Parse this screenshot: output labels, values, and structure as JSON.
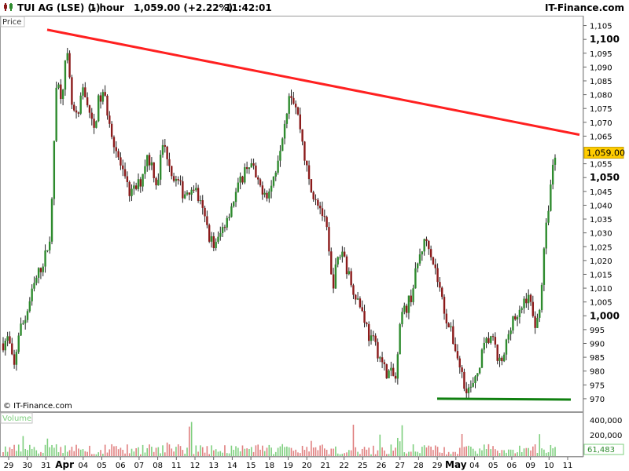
{
  "header": {
    "symbol": "TUI AG (LSE) (-)",
    "timeframe": "1 hour",
    "price_change": "1,059.00 (+2.22%)",
    "time": "11:42:01",
    "brand": "IT-Finance.com"
  },
  "price_panel": {
    "label": "Price",
    "watermark": "© IT-Finance.com",
    "current_price_label": "1,059.00"
  },
  "volume_panel": {
    "label": "Volume",
    "current_volume_label": "61,483",
    "tick_labels": [
      "400,000",
      "200,000"
    ]
  },
  "colors": {
    "up_candle": "#2e8b2e",
    "down_candle": "#8b1a1a",
    "trendline_resistance": "#ff2020",
    "trendline_support": "#108010",
    "price_tag": "#ffcc00",
    "volume_green": "#7fcf7f",
    "volume_red": "#e08080"
  },
  "chart_data": {
    "type": "candlestick",
    "y_unit": "GBp",
    "ylim": [
      966,
      1108
    ],
    "y_ticks": [
      {
        "label": "1,105",
        "value": 1105,
        "bold": false
      },
      {
        "label": "1,100",
        "value": 1100,
        "bold": true
      },
      {
        "label": "1,095",
        "value": 1095,
        "bold": false
      },
      {
        "label": "1,090",
        "value": 1090,
        "bold": false
      },
      {
        "label": "1,085",
        "value": 1085,
        "bold": false
      },
      {
        "label": "1,080",
        "value": 1080,
        "bold": false
      },
      {
        "label": "1,075",
        "value": 1075,
        "bold": false
      },
      {
        "label": "1,070",
        "value": 1070,
        "bold": false
      },
      {
        "label": "1,065",
        "value": 1065,
        "bold": false
      },
      {
        "label": "1,055",
        "value": 1055,
        "bold": false
      },
      {
        "label": "1,050",
        "value": 1050,
        "bold": true
      },
      {
        "label": "1,045",
        "value": 1045,
        "bold": false
      },
      {
        "label": "1,040",
        "value": 1040,
        "bold": false
      },
      {
        "label": "1,035",
        "value": 1035,
        "bold": false
      },
      {
        "label": "1,030",
        "value": 1030,
        "bold": false
      },
      {
        "label": "1,025",
        "value": 1025,
        "bold": false
      },
      {
        "label": "1,020",
        "value": 1020,
        "bold": false
      },
      {
        "label": "1,015",
        "value": 1015,
        "bold": false
      },
      {
        "label": "1,010",
        "value": 1010,
        "bold": false
      },
      {
        "label": "1,005",
        "value": 1005,
        "bold": false
      },
      {
        "label": "1,000",
        "value": 1000,
        "bold": true
      },
      {
        "label": "995",
        "value": 995,
        "bold": false
      },
      {
        "label": "990",
        "value": 990,
        "bold": false
      },
      {
        "label": "985",
        "value": 985,
        "bold": false
      },
      {
        "label": "980",
        "value": 980,
        "bold": false
      },
      {
        "label": "975",
        "value": 975,
        "bold": false
      },
      {
        "label": "970",
        "value": 970,
        "bold": false
      }
    ],
    "x_ticks": [
      {
        "label": "29",
        "bold": false
      },
      {
        "label": "30",
        "bold": false
      },
      {
        "label": "31",
        "bold": false
      },
      {
        "label": "Apr",
        "bold": true
      },
      {
        "label": "04",
        "bold": false
      },
      {
        "label": "05",
        "bold": false
      },
      {
        "label": "06",
        "bold": false
      },
      {
        "label": "07",
        "bold": false
      },
      {
        "label": "08",
        "bold": false
      },
      {
        "label": "11",
        "bold": false
      },
      {
        "label": "12",
        "bold": false
      },
      {
        "label": "13",
        "bold": false
      },
      {
        "label": "14",
        "bold": false
      },
      {
        "label": "15",
        "bold": false
      },
      {
        "label": "18",
        "bold": false
      },
      {
        "label": "19",
        "bold": false
      },
      {
        "label": "20",
        "bold": false
      },
      {
        "label": "21",
        "bold": false
      },
      {
        "label": "22",
        "bold": false
      },
      {
        "label": "25",
        "bold": false
      },
      {
        "label": "26",
        "bold": false
      },
      {
        "label": "27",
        "bold": false
      },
      {
        "label": "28",
        "bold": false
      },
      {
        "label": "29",
        "bold": false
      },
      {
        "label": "May",
        "bold": true
      },
      {
        "label": "04",
        "bold": false
      },
      {
        "label": "05",
        "bold": false
      },
      {
        "label": "06",
        "bold": false
      },
      {
        "label": "09",
        "bold": false
      },
      {
        "label": "10",
        "bold": false
      },
      {
        "label": "11",
        "bold": false
      }
    ],
    "price_path": [
      990,
      992,
      980,
      995,
      998,
      1005,
      1012,
      1017,
      1022,
      1030,
      1085,
      1080,
      1095,
      1075,
      1070,
      1082,
      1077,
      1066,
      1078,
      1080,
      1071,
      1062,
      1055,
      1048,
      1044,
      1046,
      1049,
      1058,
      1055,
      1047,
      1062,
      1058,
      1050,
      1048,
      1044,
      1046,
      1047,
      1041,
      1035,
      1028,
      1025,
      1030,
      1035,
      1040,
      1045,
      1050,
      1055,
      1054,
      1047,
      1046,
      1044,
      1050,
      1060,
      1070,
      1082,
      1077,
      1068,
      1055,
      1045,
      1043,
      1038,
      1030,
      1010,
      1020,
      1024,
      1015,
      1010,
      1005,
      1000,
      992,
      990,
      985,
      980,
      979,
      977,
      1000,
      1003,
      1008,
      1018,
      1025,
      1028,
      1020,
      1012,
      1003,
      996,
      990,
      982,
      975,
      973,
      976,
      985,
      990,
      993,
      985,
      982,
      992,
      1000,
      998,
      1005,
      1008,
      997,
      1000,
      1025,
      1045,
      1059
    ],
    "resistance_line": {
      "points": [
        [
          "Mar 31",
          1103.5
        ],
        [
          "May 11",
          1065.5
        ]
      ]
    },
    "support_line": {
      "points": [
        [
          "Apr 29",
          970.0
        ],
        [
          "May 11",
          969.7
        ]
      ]
    },
    "last_price": 1059.0,
    "volume": {
      "ylim": [
        0,
        480000
      ],
      "last_value": 61483
    }
  }
}
